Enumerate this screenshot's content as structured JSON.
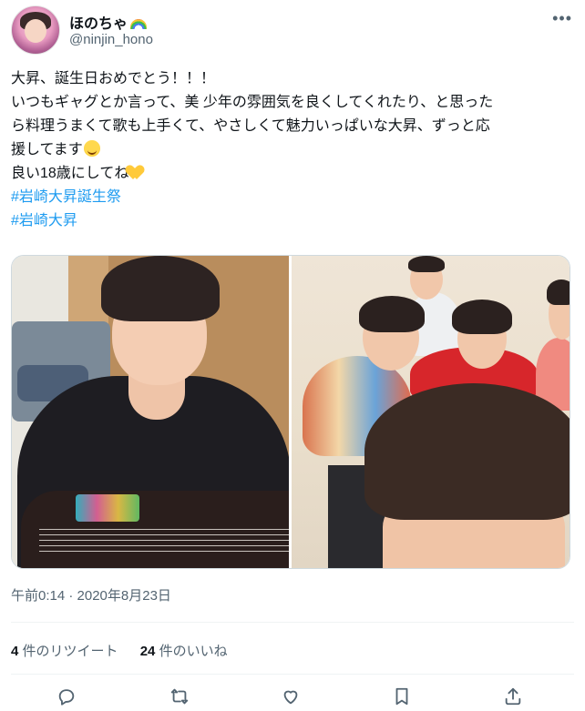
{
  "user": {
    "display_name": "ほのちゃ",
    "handle": "@ninjin_hono",
    "name_emoji": "rainbow-icon"
  },
  "more_icon": "more-horizontal-icon",
  "tweet": {
    "lines": [
      "大昇、誕生日おめでとう！！！",
      "いつもギャグとか言って、美 少年の雰囲気を良くしてくれたり、と思った",
      "ら料理うまくて歌も上手くて、やさしくて魅力いっぱいな大昇、ずっと応",
      "援してます",
      "良い18歳にしてね"
    ],
    "hashtags": [
      "#岩崎大昇誕生祭",
      "#岩崎大昇"
    ],
    "emojis": [
      "smiling-face-icon",
      "yellow-heart-icon"
    ]
  },
  "timestamp": "午前0:14 · 2020年8月23日",
  "stats": {
    "retweets_count": "4",
    "retweets_label": "件のリツイート",
    "likes_count": "24",
    "likes_label": "件のいいね"
  },
  "actions": [
    "reply-icon",
    "retweet-icon",
    "like-icon",
    "bookmark-icon",
    "share-icon"
  ],
  "colors": {
    "link": "#1d9bf0",
    "secondary_text": "#536471",
    "primary_text": "#0f1419",
    "divider": "#eff3f4"
  }
}
